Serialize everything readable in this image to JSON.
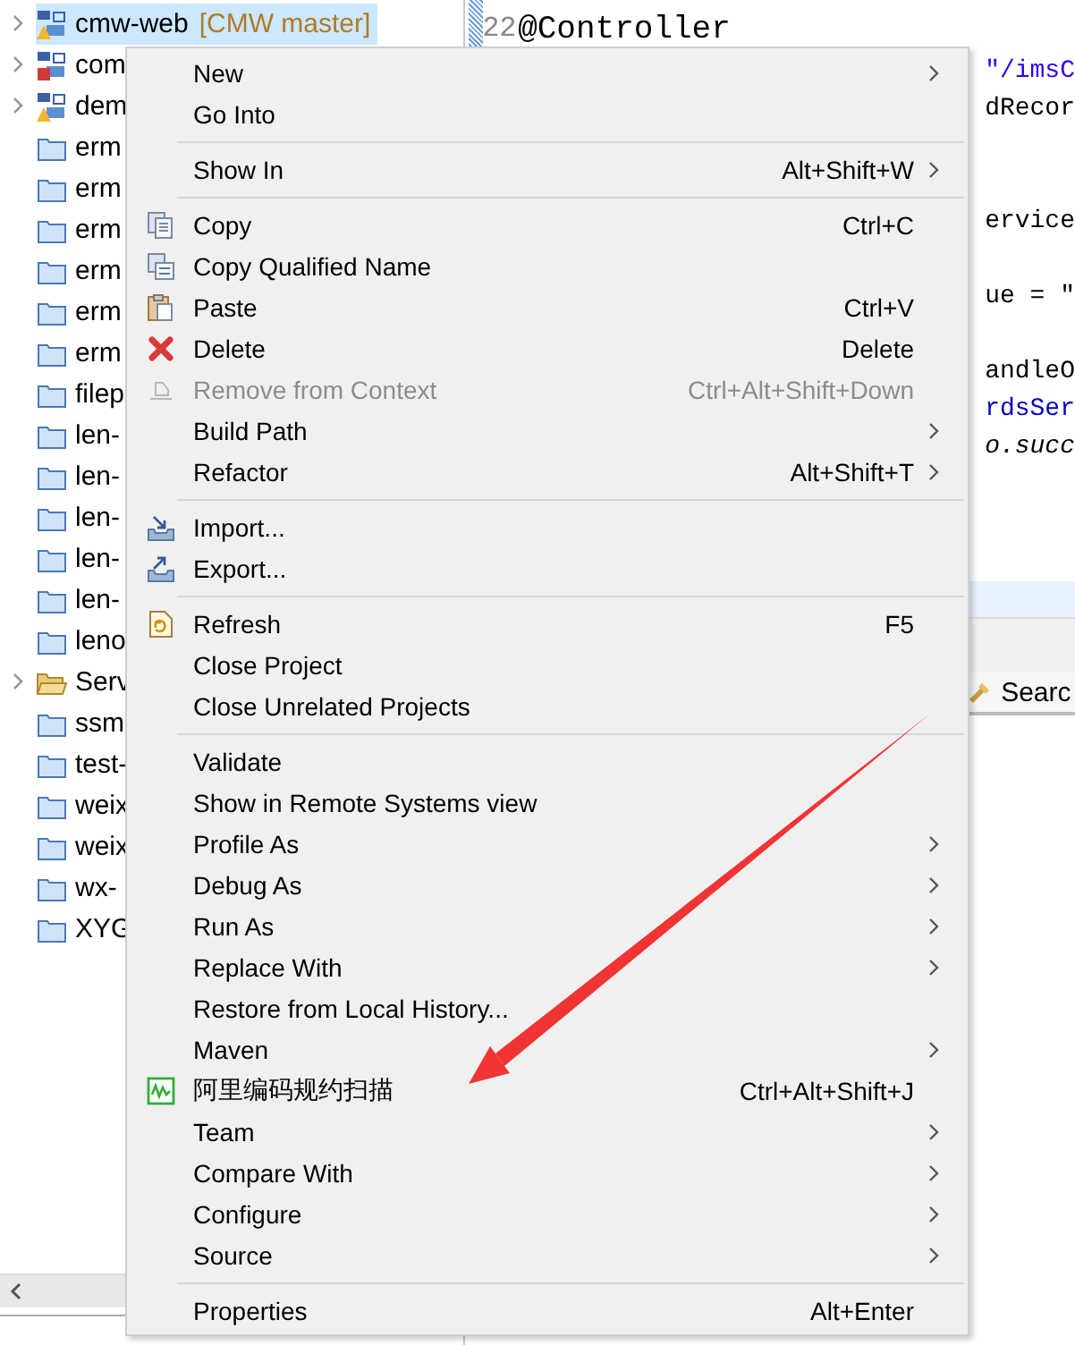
{
  "project_tree": {
    "items": [
      {
        "label": "cmw-web",
        "branch": "[CMW master]",
        "kind": "project-warning",
        "expandable": true,
        "selected": true
      },
      {
        "label": "com",
        "kind": "project-error",
        "expandable": true,
        "selected": false
      },
      {
        "label": "dem",
        "kind": "project-warning",
        "expandable": true,
        "selected": false
      },
      {
        "label": "erm",
        "kind": "folder",
        "expandable": false,
        "selected": false
      },
      {
        "label": "erm",
        "kind": "folder",
        "expandable": false,
        "selected": false
      },
      {
        "label": "erm",
        "kind": "folder",
        "expandable": false,
        "selected": false
      },
      {
        "label": "erm",
        "kind": "folder",
        "expandable": false,
        "selected": false
      },
      {
        "label": "erm",
        "kind": "folder",
        "expandable": false,
        "selected": false
      },
      {
        "label": "erm",
        "kind": "folder",
        "expandable": false,
        "selected": false
      },
      {
        "label": "filep",
        "kind": "folder",
        "expandable": false,
        "selected": false
      },
      {
        "label": "len-",
        "kind": "folder",
        "expandable": false,
        "selected": false
      },
      {
        "label": "len-",
        "kind": "folder",
        "expandable": false,
        "selected": false
      },
      {
        "label": "len-",
        "kind": "folder",
        "expandable": false,
        "selected": false
      },
      {
        "label": "len-",
        "kind": "folder",
        "expandable": false,
        "selected": false
      },
      {
        "label": "len-",
        "kind": "folder",
        "expandable": false,
        "selected": false
      },
      {
        "label": "leno",
        "kind": "folder",
        "expandable": false,
        "selected": false
      },
      {
        "label": "Serv",
        "kind": "open-folder",
        "expandable": true,
        "selected": false
      },
      {
        "label": "ssm",
        "kind": "folder",
        "expandable": false,
        "selected": false
      },
      {
        "label": "test-",
        "kind": "folder",
        "expandable": false,
        "selected": false
      },
      {
        "label": "weix",
        "kind": "folder",
        "expandable": false,
        "selected": false
      },
      {
        "label": "weix",
        "kind": "folder",
        "expandable": false,
        "selected": false
      },
      {
        "label": "wx-",
        "kind": "folder",
        "expandable": false,
        "selected": false
      },
      {
        "label": "XYG",
        "kind": "folder",
        "expandable": false,
        "selected": false
      }
    ]
  },
  "editor": {
    "lines": [
      {
        "number": "22",
        "text": "@Controller"
      }
    ],
    "fragments": [
      {
        "text": "\"/imsC",
        "kind": "string"
      },
      {
        "text": "dRecor",
        "kind": "plain"
      },
      {
        "text": "ervice",
        "kind": "plain"
      },
      {
        "text": "ue = \"",
        "kind": "plain"
      },
      {
        "text": "andleO",
        "kind": "plain"
      },
      {
        "text": "rdsSer",
        "kind": "field"
      },
      {
        "text": "o.succ",
        "kind": "static"
      }
    ]
  },
  "lower_panel": {
    "tab": "Searc"
  },
  "context_menu": {
    "groups": [
      [
        {
          "label": "New",
          "submenu": true,
          "disabled": false
        },
        {
          "label": "Go Into",
          "submenu": false,
          "disabled": false
        }
      ],
      [
        {
          "label": "Show In",
          "shortcut": "Alt+Shift+W",
          "submenu": true,
          "disabled": false
        }
      ],
      [
        {
          "label": "Copy",
          "kind": "copy",
          "shortcut": "Ctrl+C",
          "submenu": false,
          "disabled": false
        },
        {
          "label": "Copy Qualified Name",
          "kind": "copy-qualified",
          "submenu": false,
          "disabled": false
        },
        {
          "label": "Paste",
          "kind": "paste",
          "shortcut": "Ctrl+V",
          "submenu": false,
          "disabled": false
        },
        {
          "label": "Delete",
          "kind": "delete",
          "shortcut": "Delete",
          "submenu": false,
          "disabled": false
        },
        {
          "label": "Remove from Context",
          "kind": "remove",
          "shortcut": "Ctrl+Alt+Shift+Down",
          "submenu": false,
          "disabled": true
        },
        {
          "label": "Build Path",
          "submenu": true,
          "disabled": false
        },
        {
          "label": "Refactor",
          "shortcut": "Alt+Shift+T",
          "submenu": true,
          "disabled": false
        }
      ],
      [
        {
          "label": "Import...",
          "kind": "import",
          "submenu": false,
          "disabled": false
        },
        {
          "label": "Export...",
          "kind": "export",
          "submenu": false,
          "disabled": false
        }
      ],
      [
        {
          "label": "Refresh",
          "kind": "refresh",
          "shortcut": "F5",
          "submenu": false,
          "disabled": false
        },
        {
          "label": "Close Project",
          "submenu": false,
          "disabled": false
        },
        {
          "label": "Close Unrelated Projects",
          "submenu": false,
          "disabled": false
        }
      ],
      [
        {
          "label": "Validate",
          "submenu": false,
          "disabled": false
        },
        {
          "label": "Show in Remote Systems view",
          "submenu": false,
          "disabled": false
        },
        {
          "label": "Profile As",
          "submenu": true,
          "disabled": false
        },
        {
          "label": "Debug As",
          "submenu": true,
          "disabled": false
        },
        {
          "label": "Run As",
          "submenu": true,
          "disabled": false
        },
        {
          "label": "Replace With",
          "submenu": true,
          "disabled": false
        },
        {
          "label": "Restore from Local History...",
          "submenu": false,
          "disabled": false
        },
        {
          "label": "Maven",
          "submenu": true,
          "disabled": false
        },
        {
          "label": "阿里编码规约扫描",
          "kind": "scan",
          "shortcut": "Ctrl+Alt+Shift+J",
          "submenu": false,
          "disabled": false
        },
        {
          "label": "Team",
          "submenu": true,
          "disabled": false
        },
        {
          "label": "Compare With",
          "submenu": true,
          "disabled": false
        },
        {
          "label": "Configure",
          "submenu": true,
          "disabled": false
        },
        {
          "label": "Source",
          "submenu": true,
          "disabled": false
        }
      ],
      [
        {
          "label": "Properties",
          "shortcut": "Alt+Enter",
          "submenu": false,
          "disabled": false
        }
      ]
    ]
  }
}
